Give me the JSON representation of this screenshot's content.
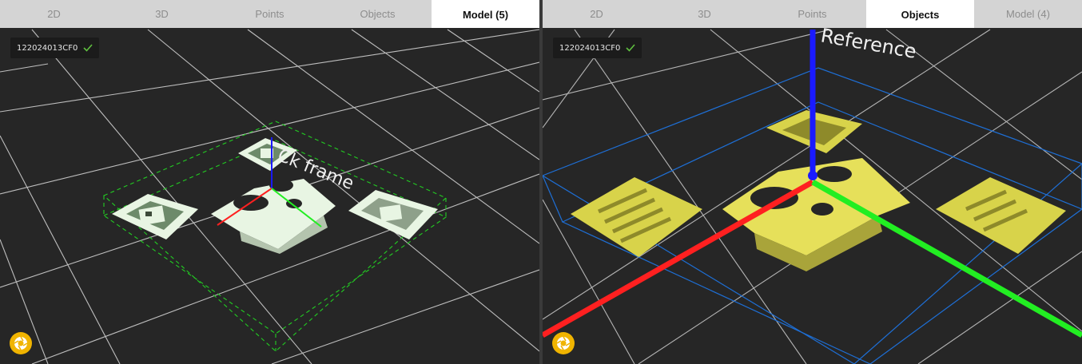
{
  "left_panel": {
    "tabs": [
      {
        "label": "2D",
        "active": false
      },
      {
        "label": "3D",
        "active": false
      },
      {
        "label": "Points",
        "active": false
      },
      {
        "label": "Objects",
        "active": false
      },
      {
        "label": "Model (5)",
        "active": true
      }
    ],
    "device": {
      "serial": "122024013CF0",
      "status_icon": "check-icon"
    },
    "scene_label": "Ck frame",
    "capture_icon": "shutter-icon"
  },
  "right_panel": {
    "tabs": [
      {
        "label": "2D",
        "active": false
      },
      {
        "label": "3D",
        "active": false
      },
      {
        "label": "Points",
        "active": false
      },
      {
        "label": "Objects",
        "active": true
      },
      {
        "label": "Model (4)",
        "active": false
      }
    ],
    "device": {
      "serial": "122024013CF0",
      "status_icon": "check-icon"
    },
    "scene_label": "Reference",
    "capture_icon": "shutter-icon"
  },
  "colors": {
    "background": "#262626",
    "grid": "#d9d9d9",
    "model_points": "#e8f5e3",
    "object_points": "#d8d34a",
    "axis_x": "#ff2020",
    "axis_y": "#22ee22",
    "axis_z": "#1a1aff",
    "bbox_left": "#22cc22",
    "bbox_right": "#1e6fd6",
    "status_ok": "#5fbf3f",
    "capture_button": "#f0b400"
  }
}
